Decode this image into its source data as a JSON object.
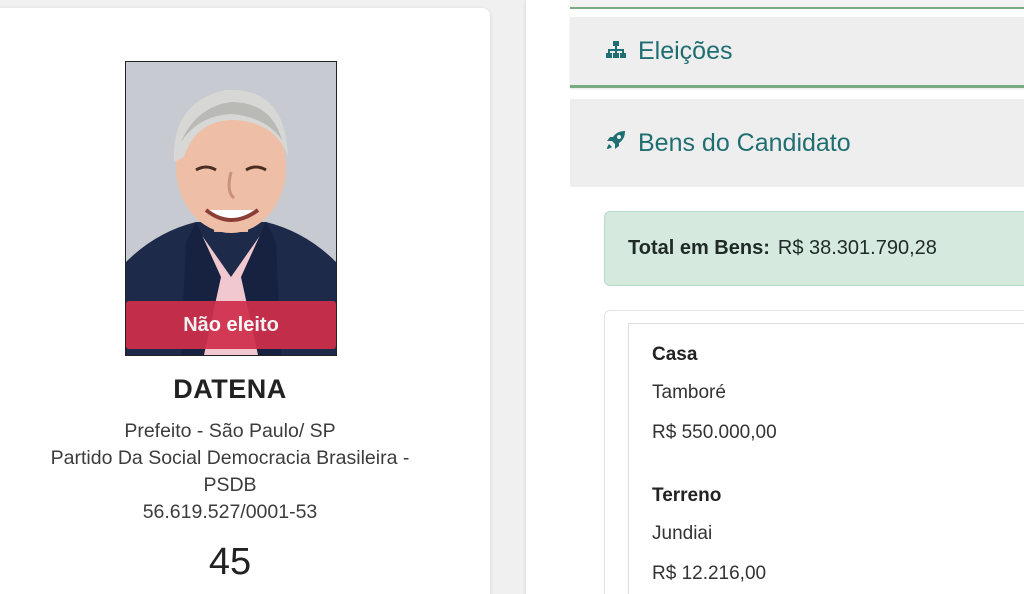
{
  "candidate": {
    "status_badge": "Não eleito",
    "name": "DATENA",
    "office": "Prefeito - São Paulo/ SP",
    "party_line1": "Partido Da Social Democracia Brasileira -",
    "party_line2": "PSDB",
    "cnpj": "56.619.527/0001-53",
    "number": "45",
    "status_color": "#cf2f4b"
  },
  "sections": {
    "elections": {
      "label": "Eleições",
      "icon": "sitemap-icon"
    },
    "assets": {
      "label": "Bens do Candidato",
      "icon": "rocket-icon"
    }
  },
  "assets_summary": {
    "total_label": "Total em Bens:",
    "total_value": "R$ 38.301.790,28"
  },
  "assets": [
    {
      "type": "Casa",
      "description": "Tamboré",
      "value": "R$ 550.000,00"
    },
    {
      "type": "Terreno",
      "description": "Jundiai",
      "value": "R$ 12.216,00"
    }
  ],
  "colors": {
    "accent_teal": "#1f6e72",
    "accent_green": "#79aa81",
    "summary_bg": "#d5e9df"
  }
}
